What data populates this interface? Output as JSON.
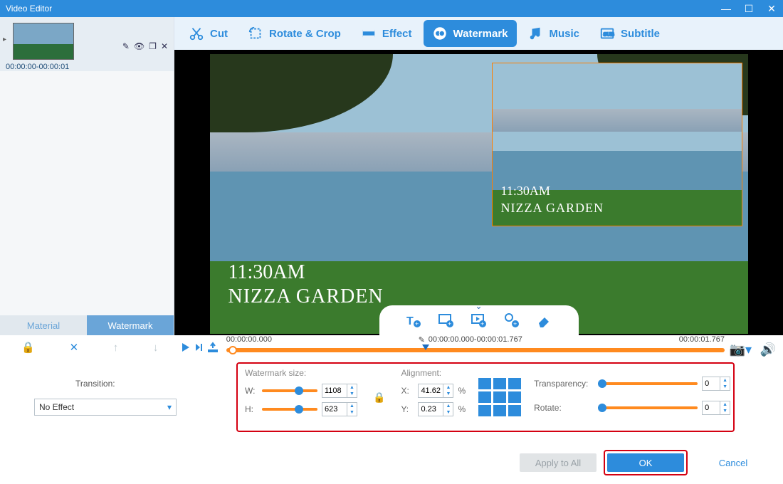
{
  "title": "Video Editor",
  "thumb_time": "00:00:00-00:00:01",
  "tabs": {
    "cut": "Cut",
    "rotate": "Rotate & Crop",
    "effect": "Effect",
    "watermark": "Watermark",
    "music": "Music",
    "subtitle": "Subtitle"
  },
  "mat_tabs": {
    "material": "Material",
    "watermark": "Watermark"
  },
  "preview": {
    "time1": "11:30AM",
    "time2": "NIZZA GARDEN"
  },
  "timeline": {
    "start": "00:00:00.000",
    "range": "00:00:00.000-00:00:01.767",
    "end": "00:00:01.767"
  },
  "settings": {
    "size_head": "Watermark size:",
    "w_label": "W:",
    "w_val": "1108",
    "h_label": "H:",
    "h_val": "623",
    "align_head": "Alignment:",
    "x_label": "X:",
    "x_val": "41.62",
    "pct": "%",
    "y_label": "Y:",
    "y_val": "0.23",
    "transp_label": "Transparency:",
    "transp_val": "0",
    "rotate_label": "Rotate:",
    "rotate_val": "0"
  },
  "transition": {
    "label": "Transition:",
    "value": "No Effect"
  },
  "buttons": {
    "apply": "Apply to All",
    "ok": "OK",
    "cancel": "Cancel"
  }
}
